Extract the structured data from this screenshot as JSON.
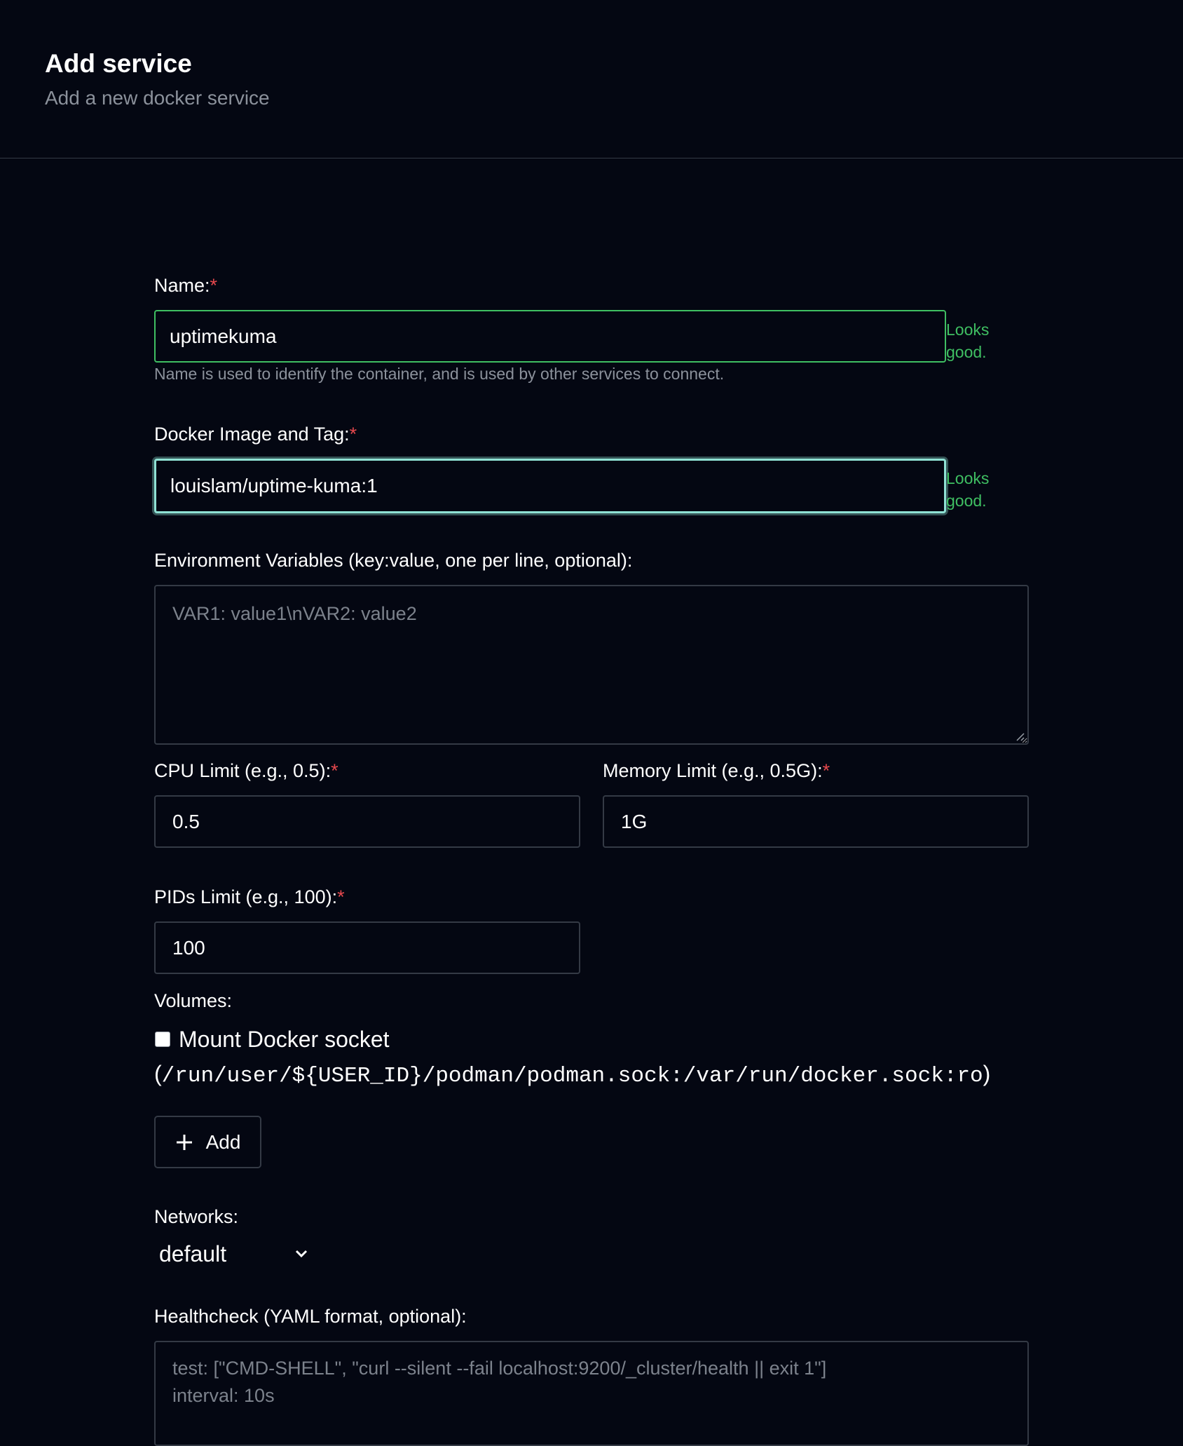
{
  "header": {
    "title": "Add service",
    "subtitle": "Add a new docker service"
  },
  "form": {
    "required_mark": "*",
    "name": {
      "label": "Name:",
      "value": "uptimekuma",
      "feedback": "Looks good.",
      "help": "Name is used to identify the container, and is used by other services to connect."
    },
    "image": {
      "label": "Docker Image and Tag:",
      "value": "louislam/uptime-kuma:1",
      "feedback": "Looks good."
    },
    "env": {
      "label": "Environment Variables (key:value, one per line, optional):",
      "placeholder": "VAR1: value1\\nVAR2: value2"
    },
    "cpu": {
      "label": "CPU Limit (e.g., 0.5):",
      "value": "0.5"
    },
    "memory": {
      "label": "Memory Limit (e.g., 0.5G):",
      "value": "1G"
    },
    "pids": {
      "label": "PIDs Limit (e.g., 100):",
      "value": "100"
    },
    "volumes": {
      "label": "Volumes:",
      "mount_label": "Mount Docker socket",
      "mount_checked": false,
      "mount_path_open": "(",
      "mount_path": "/run/user/${USER_ID}/podman/podman.sock:/var/run/docker.sock:ro",
      "mount_path_close": ")",
      "add_label": "Add"
    },
    "networks": {
      "label": "Networks:",
      "selected": "default"
    },
    "healthcheck": {
      "label": "Healthcheck (YAML format, optional):",
      "placeholder_line1": "test: [\"CMD-SHELL\", \"curl --silent --fail localhost:9200/_cluster/health || exit 1\"]",
      "placeholder_line2": "interval: 10s"
    }
  },
  "icons": {
    "add": "plus-icon",
    "networks_dropdown": "chevron-down-icon",
    "resize": "resize-grip-icon"
  },
  "colors": {
    "background": "#040712",
    "valid": "#3fbf62",
    "required": "#e5484d",
    "focus": "#8fe1d4"
  }
}
